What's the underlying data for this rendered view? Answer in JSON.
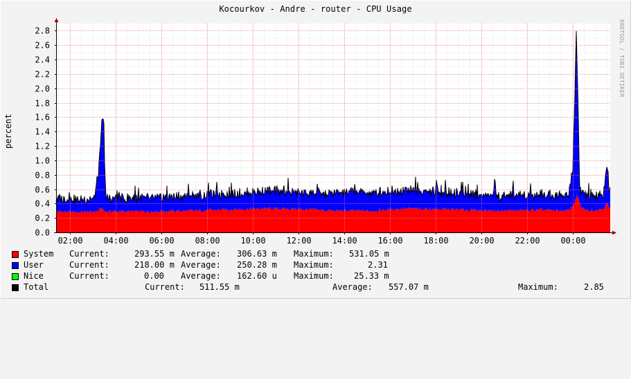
{
  "title": "Kocourkov - Andre - router - CPU Usage",
  "watermark": "RRDTOOL / TOBI OETIKER",
  "chart_data": {
    "type": "area",
    "ylabel": "percent",
    "ylim": [
      0,
      2.9
    ],
    "yticks": [
      "0.0",
      "0.2",
      "0.4",
      "0.6",
      "0.8",
      "1.0",
      "1.2",
      "1.4",
      "1.6",
      "1.8",
      "2.0",
      "2.2",
      "2.4",
      "2.6",
      "2.8"
    ],
    "xticks": [
      "02:00",
      "04:00",
      "06:00",
      "08:00",
      "10:00",
      "12:00",
      "14:00",
      "16:00",
      "18:00",
      "20:00",
      "22:00",
      "00:00"
    ],
    "grid": true,
    "stacked": true,
    "series": [
      {
        "name": "System",
        "color": "#ff0000",
        "keyframes": [
          [
            0,
            0.29
          ],
          [
            30,
            0.28
          ],
          [
            60,
            0.29
          ],
          [
            65,
            0.34
          ],
          [
            70,
            0.29
          ],
          [
            120,
            0.29
          ],
          [
            200,
            0.3
          ],
          [
            260,
            0.32
          ],
          [
            300,
            0.33
          ],
          [
            360,
            0.32
          ],
          [
            400,
            0.3
          ],
          [
            460,
            0.3
          ],
          [
            500,
            0.33
          ],
          [
            560,
            0.32
          ],
          [
            600,
            0.31
          ],
          [
            640,
            0.3
          ],
          [
            700,
            0.31
          ],
          [
            740,
            0.3
          ],
          [
            748,
            0.4
          ],
          [
            752,
            0.52
          ],
          [
            758,
            0.34
          ],
          [
            768,
            0.3
          ],
          [
            790,
            0.33
          ],
          [
            795,
            0.4
          ],
          [
            800,
            0.32
          ]
        ]
      },
      {
        "name": "User",
        "color": "#0000ff",
        "keyframes": [
          [
            0,
            0.18
          ],
          [
            30,
            0.17
          ],
          [
            55,
            0.18
          ],
          [
            62,
            0.6
          ],
          [
            64,
            0.85
          ],
          [
            66,
            1.15
          ],
          [
            68,
            1.23
          ],
          [
            70,
            0.72
          ],
          [
            72,
            0.18
          ],
          [
            100,
            0.18
          ],
          [
            150,
            0.19
          ],
          [
            200,
            0.21
          ],
          [
            260,
            0.22
          ],
          [
            300,
            0.24
          ],
          [
            360,
            0.23
          ],
          [
            380,
            0.22
          ],
          [
            400,
            0.24
          ],
          [
            430,
            0.26
          ],
          [
            460,
            0.25
          ],
          [
            500,
            0.26
          ],
          [
            560,
            0.23
          ],
          [
            600,
            0.22
          ],
          [
            640,
            0.21
          ],
          [
            700,
            0.21
          ],
          [
            740,
            0.22
          ],
          [
            746,
            0.55
          ],
          [
            749,
            1.5
          ],
          [
            751,
            2.33
          ],
          [
            753,
            1.5
          ],
          [
            756,
            0.22
          ],
          [
            770,
            0.19
          ],
          [
            790,
            0.2
          ],
          [
            795,
            0.5
          ],
          [
            798,
            0.28
          ],
          [
            800,
            0.25
          ]
        ]
      },
      {
        "name": "Nice",
        "color": "#00ff00",
        "keyframes": [
          [
            0,
            0.0001
          ],
          [
            800,
            0.0002
          ]
        ]
      }
    ],
    "total_color": "#000000"
  },
  "legend": [
    {
      "name": "System",
      "color": "#ff0000",
      "current_label": "Current:",
      "current": "293.55 m",
      "average_label": "Average:",
      "average": "306.63 m",
      "maximum_label": "Maximum:",
      "maximum": "531.05 m"
    },
    {
      "name": "User",
      "color": "#0000ff",
      "current_label": "Current:",
      "current": "218.00 m",
      "average_label": "Average:",
      "average": "250.28 m",
      "maximum_label": "Maximum:",
      "maximum": "2.31"
    },
    {
      "name": "Nice",
      "color": "#00ff00",
      "current_label": "Current:",
      "current": "0.00",
      "average_label": "Average:",
      "average": "162.60 u",
      "maximum_label": "Maximum:",
      "maximum": "25.33 m"
    },
    {
      "name": "Total",
      "color": "#000000",
      "current_label": "Current:",
      "current": "511.55 m",
      "average_label": "Average:",
      "average": "557.07 m",
      "maximum_label": "Maximum:",
      "maximum": "2.85"
    }
  ]
}
